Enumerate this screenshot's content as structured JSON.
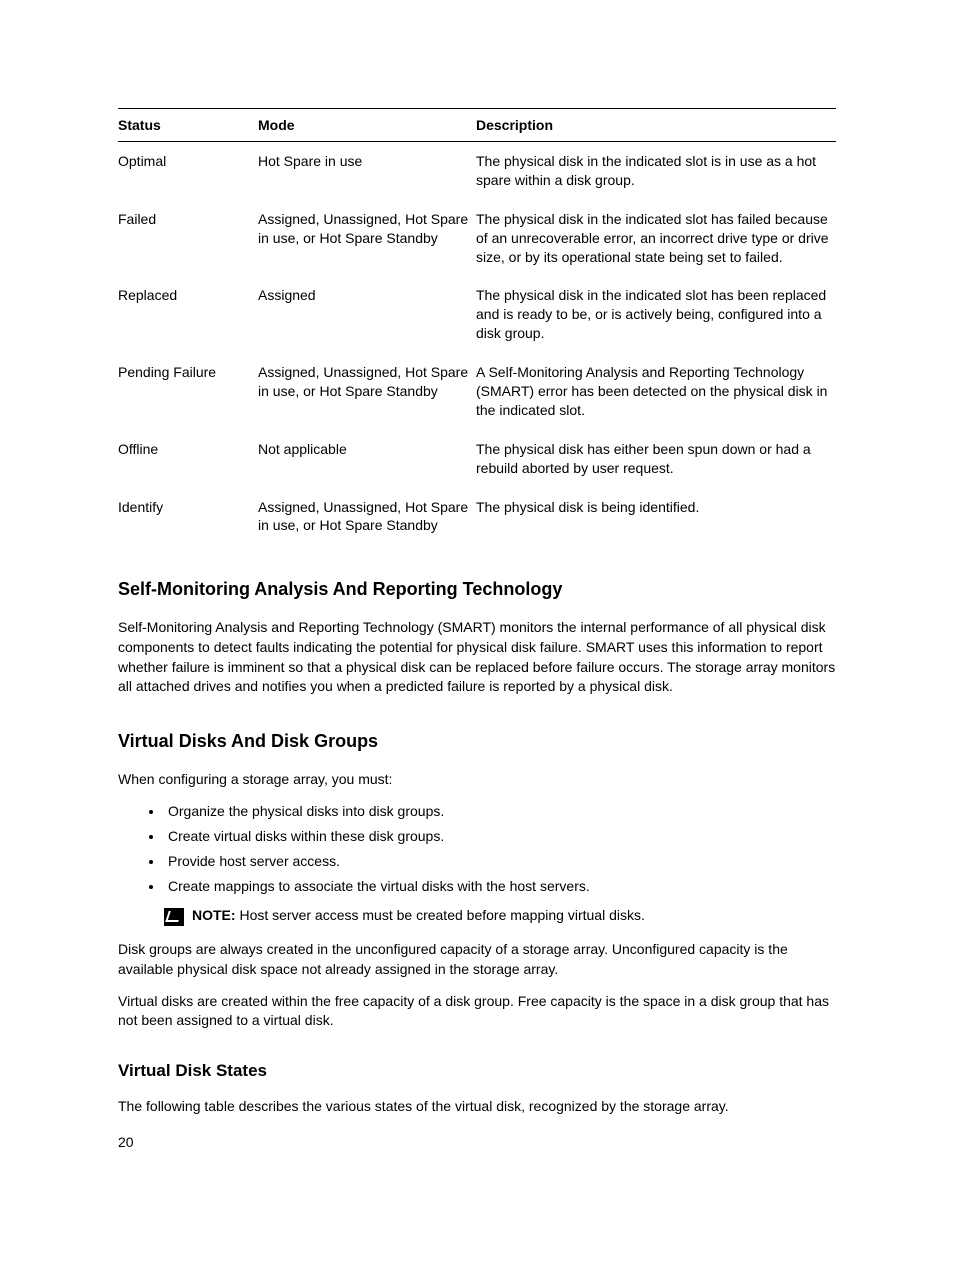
{
  "table": {
    "headers": {
      "status": "Status",
      "mode": "Mode",
      "description": "Description"
    },
    "rows": [
      {
        "status": "Optimal",
        "mode": "Hot Spare in use",
        "description": "The physical disk in the indicated slot is in use as a hot spare within a disk group."
      },
      {
        "status": "Failed",
        "mode": "Assigned, Unassigned, Hot Spare in use, or Hot Spare Standby",
        "description": "The physical disk in the indicated slot has failed because of an unrecoverable error, an incorrect drive type or drive size, or by its operational state being set to failed."
      },
      {
        "status": "Replaced",
        "mode": "Assigned",
        "description": "The physical disk in the indicated slot has been replaced and is ready to be, or is actively being, configured into a disk group."
      },
      {
        "status": "Pending Failure",
        "mode": "Assigned, Unassigned, Hot Spare in use, or Hot Spare Standby",
        "description": "A Self-Monitoring Analysis and Reporting Technology (SMART) error has been detected on the physical disk in the indicated slot."
      },
      {
        "status": "Offline",
        "mode": "Not applicable",
        "description": "The physical disk has either been spun down or had a rebuild aborted by user request."
      },
      {
        "status": "Identify",
        "mode": "Assigned, Unassigned, Hot Spare in use, or Hot Spare Standby",
        "description": "The physical disk is being identified."
      }
    ]
  },
  "sections": {
    "smart": {
      "heading": "Self-Monitoring Analysis And Reporting Technology",
      "body": "Self-Monitoring Analysis and Reporting Technology (SMART) monitors the internal performance of all physical disk components to detect faults indicating the potential for physical disk failure. SMART uses this information to report whether failure is imminent so that a physical disk can be replaced before failure occurs. The storage array monitors all attached drives and notifies you when a predicted failure is reported by a physical disk."
    },
    "vdisk_groups": {
      "heading": "Virtual Disks And Disk Groups",
      "intro": "When configuring a storage array, you must:",
      "items": [
        "Organize the physical disks into disk groups.",
        "Create virtual disks within these disk groups.",
        "Provide host server access.",
        "Create mappings to associate the virtual disks with the host servers."
      ],
      "note_label": "NOTE: ",
      "note_text": "Host server access must be created before mapping virtual disks.",
      "para1": "Disk groups are always created in the unconfigured capacity of a storage array. Unconfigured capacity is the available physical disk space not already assigned in the storage array.",
      "para2": "Virtual disks are created within the free capacity of a disk group. Free capacity is the space in a disk group that has not been assigned to a virtual disk."
    },
    "vdisk_states": {
      "heading": "Virtual Disk States",
      "body": "The following table describes the various states of the virtual disk, recognized by the storage array."
    }
  },
  "page_number": "20"
}
